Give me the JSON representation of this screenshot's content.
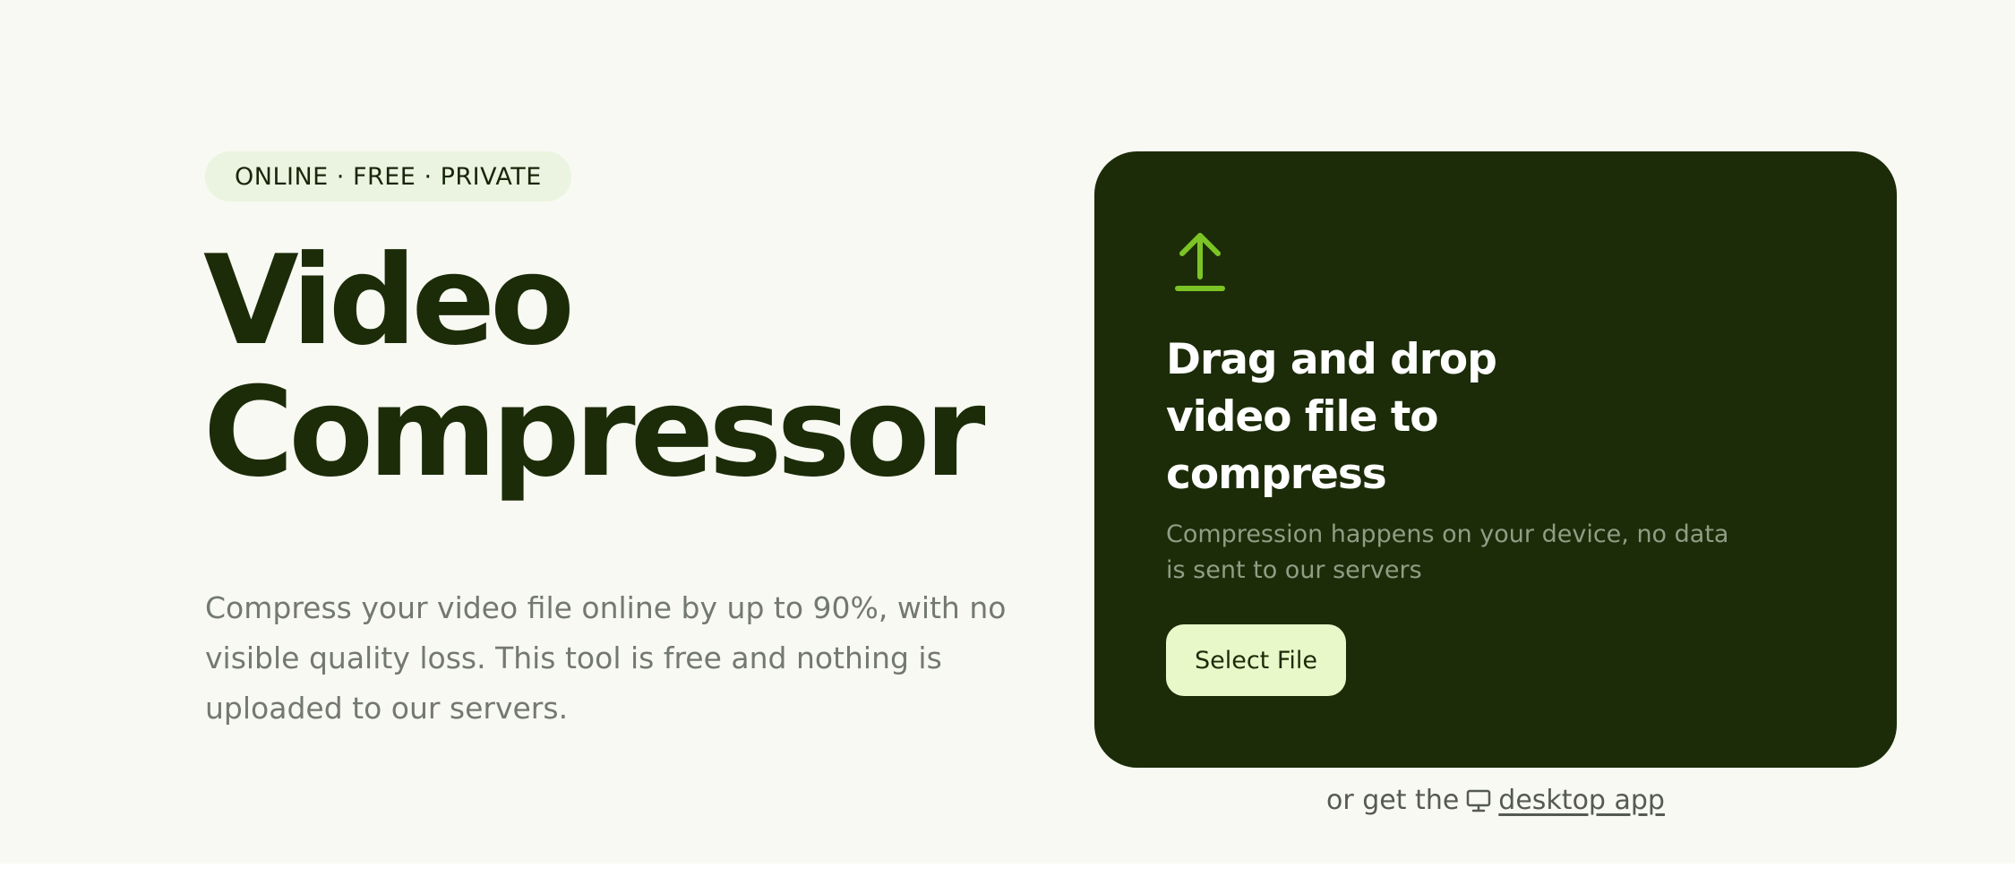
{
  "badge": {
    "text": "ONLINE · FREE · PRIVATE"
  },
  "hero": {
    "title_line1": "Video",
    "title_line2": "Compressor",
    "description": "Compress your video file online by up to 90%, with no visible quality loss. This tool is free and nothing is uploaded to our servers."
  },
  "dropzone": {
    "icon": "upload-icon",
    "heading": "Drag and drop video file to compress",
    "subtext": "Compression happens on your device, no data is sent to our servers",
    "button_label": "Select File"
  },
  "desktop": {
    "prefix": "or get the",
    "icon": "monitor-icon",
    "link_text": "desktop app"
  },
  "colors": {
    "background": "#f8f9f2",
    "card": "#1c2c09",
    "accent": "#7cc425",
    "button": "#e8f8c9",
    "title": "#1c2c09"
  }
}
